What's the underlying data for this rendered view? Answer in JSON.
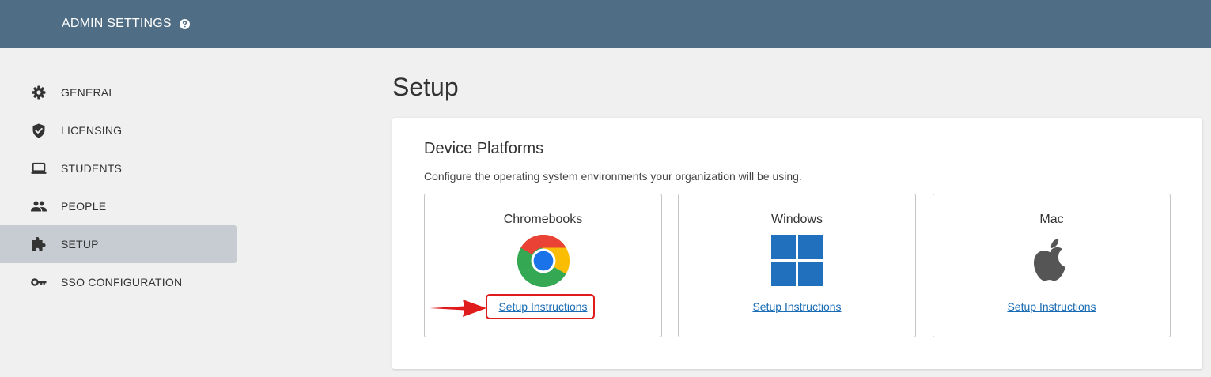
{
  "header": {
    "title": "ADMIN SETTINGS",
    "help_icon": "question-circle-icon"
  },
  "sidebar": {
    "items": [
      {
        "label": "GENERAL",
        "icon": "gear-icon",
        "active": false
      },
      {
        "label": "LICENSING",
        "icon": "shield-check-icon",
        "active": false
      },
      {
        "label": "STUDENTS",
        "icon": "laptop-icon",
        "active": false
      },
      {
        "label": "PEOPLE",
        "icon": "people-icon",
        "active": false
      },
      {
        "label": "SETUP",
        "icon": "puzzle-icon",
        "active": true
      },
      {
        "label": "SSO CONFIGURATION",
        "icon": "key-icon",
        "active": false
      }
    ]
  },
  "main": {
    "title": "Setup",
    "card": {
      "title": "Device Platforms",
      "description": "Configure the operating system environments your organization will be using.",
      "platforms": [
        {
          "name": "Chromebooks",
          "icon": "chrome-logo-icon",
          "link": "Setup Instructions",
          "highlighted": true
        },
        {
          "name": "Windows",
          "icon": "windows-logo-icon",
          "link": "Setup Instructions",
          "highlighted": false
        },
        {
          "name": "Mac",
          "icon": "apple-logo-icon",
          "link": "Setup Instructions",
          "highlighted": false
        }
      ]
    }
  },
  "colors": {
    "header_bg": "#4f6d85",
    "active_nav_bg": "#c6ccd2",
    "link": "#1a6cb5",
    "annotation": "#e01b1b",
    "windows_blue": "#2170bd",
    "apple_gray": "#555555"
  }
}
